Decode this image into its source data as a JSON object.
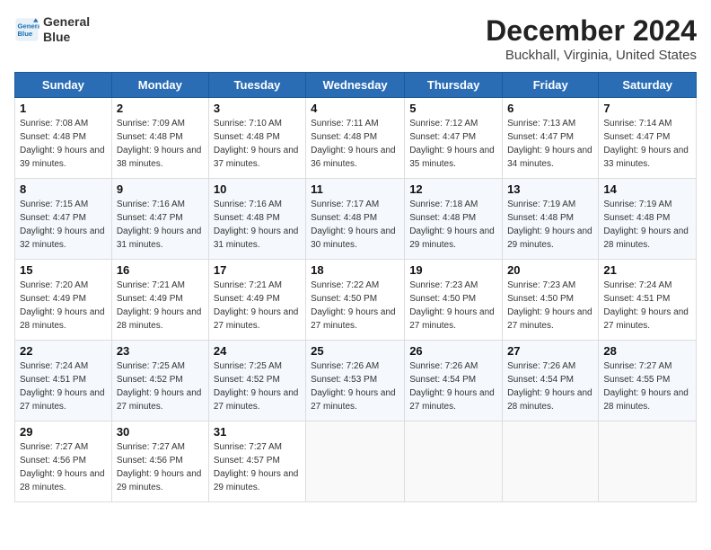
{
  "header": {
    "logo_line1": "General",
    "logo_line2": "Blue",
    "title": "December 2024",
    "location": "Buckhall, Virginia, United States"
  },
  "days_of_week": [
    "Sunday",
    "Monday",
    "Tuesday",
    "Wednesday",
    "Thursday",
    "Friday",
    "Saturday"
  ],
  "weeks": [
    [
      {
        "day": "1",
        "sunrise": "Sunrise: 7:08 AM",
        "sunset": "Sunset: 4:48 PM",
        "daylight": "Daylight: 9 hours and 39 minutes."
      },
      {
        "day": "2",
        "sunrise": "Sunrise: 7:09 AM",
        "sunset": "Sunset: 4:48 PM",
        "daylight": "Daylight: 9 hours and 38 minutes."
      },
      {
        "day": "3",
        "sunrise": "Sunrise: 7:10 AM",
        "sunset": "Sunset: 4:48 PM",
        "daylight": "Daylight: 9 hours and 37 minutes."
      },
      {
        "day": "4",
        "sunrise": "Sunrise: 7:11 AM",
        "sunset": "Sunset: 4:48 PM",
        "daylight": "Daylight: 9 hours and 36 minutes."
      },
      {
        "day": "5",
        "sunrise": "Sunrise: 7:12 AM",
        "sunset": "Sunset: 4:47 PM",
        "daylight": "Daylight: 9 hours and 35 minutes."
      },
      {
        "day": "6",
        "sunrise": "Sunrise: 7:13 AM",
        "sunset": "Sunset: 4:47 PM",
        "daylight": "Daylight: 9 hours and 34 minutes."
      },
      {
        "day": "7",
        "sunrise": "Sunrise: 7:14 AM",
        "sunset": "Sunset: 4:47 PM",
        "daylight": "Daylight: 9 hours and 33 minutes."
      }
    ],
    [
      {
        "day": "8",
        "sunrise": "Sunrise: 7:15 AM",
        "sunset": "Sunset: 4:47 PM",
        "daylight": "Daylight: 9 hours and 32 minutes."
      },
      {
        "day": "9",
        "sunrise": "Sunrise: 7:16 AM",
        "sunset": "Sunset: 4:47 PM",
        "daylight": "Daylight: 9 hours and 31 minutes."
      },
      {
        "day": "10",
        "sunrise": "Sunrise: 7:16 AM",
        "sunset": "Sunset: 4:48 PM",
        "daylight": "Daylight: 9 hours and 31 minutes."
      },
      {
        "day": "11",
        "sunrise": "Sunrise: 7:17 AM",
        "sunset": "Sunset: 4:48 PM",
        "daylight": "Daylight: 9 hours and 30 minutes."
      },
      {
        "day": "12",
        "sunrise": "Sunrise: 7:18 AM",
        "sunset": "Sunset: 4:48 PM",
        "daylight": "Daylight: 9 hours and 29 minutes."
      },
      {
        "day": "13",
        "sunrise": "Sunrise: 7:19 AM",
        "sunset": "Sunset: 4:48 PM",
        "daylight": "Daylight: 9 hours and 29 minutes."
      },
      {
        "day": "14",
        "sunrise": "Sunrise: 7:19 AM",
        "sunset": "Sunset: 4:48 PM",
        "daylight": "Daylight: 9 hours and 28 minutes."
      }
    ],
    [
      {
        "day": "15",
        "sunrise": "Sunrise: 7:20 AM",
        "sunset": "Sunset: 4:49 PM",
        "daylight": "Daylight: 9 hours and 28 minutes."
      },
      {
        "day": "16",
        "sunrise": "Sunrise: 7:21 AM",
        "sunset": "Sunset: 4:49 PM",
        "daylight": "Daylight: 9 hours and 28 minutes."
      },
      {
        "day": "17",
        "sunrise": "Sunrise: 7:21 AM",
        "sunset": "Sunset: 4:49 PM",
        "daylight": "Daylight: 9 hours and 27 minutes."
      },
      {
        "day": "18",
        "sunrise": "Sunrise: 7:22 AM",
        "sunset": "Sunset: 4:50 PM",
        "daylight": "Daylight: 9 hours and 27 minutes."
      },
      {
        "day": "19",
        "sunrise": "Sunrise: 7:23 AM",
        "sunset": "Sunset: 4:50 PM",
        "daylight": "Daylight: 9 hours and 27 minutes."
      },
      {
        "day": "20",
        "sunrise": "Sunrise: 7:23 AM",
        "sunset": "Sunset: 4:50 PM",
        "daylight": "Daylight: 9 hours and 27 minutes."
      },
      {
        "day": "21",
        "sunrise": "Sunrise: 7:24 AM",
        "sunset": "Sunset: 4:51 PM",
        "daylight": "Daylight: 9 hours and 27 minutes."
      }
    ],
    [
      {
        "day": "22",
        "sunrise": "Sunrise: 7:24 AM",
        "sunset": "Sunset: 4:51 PM",
        "daylight": "Daylight: 9 hours and 27 minutes."
      },
      {
        "day": "23",
        "sunrise": "Sunrise: 7:25 AM",
        "sunset": "Sunset: 4:52 PM",
        "daylight": "Daylight: 9 hours and 27 minutes."
      },
      {
        "day": "24",
        "sunrise": "Sunrise: 7:25 AM",
        "sunset": "Sunset: 4:52 PM",
        "daylight": "Daylight: 9 hours and 27 minutes."
      },
      {
        "day": "25",
        "sunrise": "Sunrise: 7:26 AM",
        "sunset": "Sunset: 4:53 PM",
        "daylight": "Daylight: 9 hours and 27 minutes."
      },
      {
        "day": "26",
        "sunrise": "Sunrise: 7:26 AM",
        "sunset": "Sunset: 4:54 PM",
        "daylight": "Daylight: 9 hours and 27 minutes."
      },
      {
        "day": "27",
        "sunrise": "Sunrise: 7:26 AM",
        "sunset": "Sunset: 4:54 PM",
        "daylight": "Daylight: 9 hours and 28 minutes."
      },
      {
        "day": "28",
        "sunrise": "Sunrise: 7:27 AM",
        "sunset": "Sunset: 4:55 PM",
        "daylight": "Daylight: 9 hours and 28 minutes."
      }
    ],
    [
      {
        "day": "29",
        "sunrise": "Sunrise: 7:27 AM",
        "sunset": "Sunset: 4:56 PM",
        "daylight": "Daylight: 9 hours and 28 minutes."
      },
      {
        "day": "30",
        "sunrise": "Sunrise: 7:27 AM",
        "sunset": "Sunset: 4:56 PM",
        "daylight": "Daylight: 9 hours and 29 minutes."
      },
      {
        "day": "31",
        "sunrise": "Sunrise: 7:27 AM",
        "sunset": "Sunset: 4:57 PM",
        "daylight": "Daylight: 9 hours and 29 minutes."
      },
      null,
      null,
      null,
      null
    ]
  ]
}
